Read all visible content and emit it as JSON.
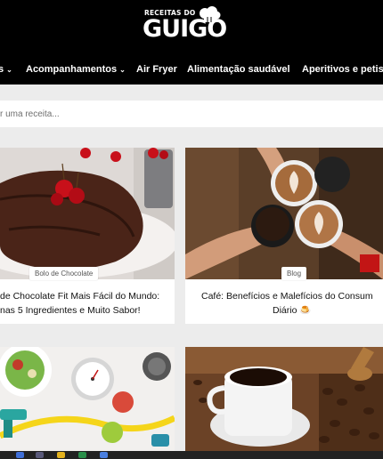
{
  "logo": {
    "top_text": "RECEITAS DO",
    "main_text": "GUIGO"
  },
  "nav": {
    "items": [
      {
        "label": "s",
        "has_chevron": true
      },
      {
        "label": "Acompanhamentos",
        "has_chevron": true
      },
      {
        "label": "Air Fryer",
        "has_chevron": false
      },
      {
        "label": "Alimentação saudável",
        "has_chevron": false
      },
      {
        "label": "Aperitivos e petisc",
        "has_chevron": false
      }
    ]
  },
  "search": {
    "placeholder": "r uma receita..."
  },
  "cards": [
    {
      "category": "Bolo de Chocolate",
      "title_line1": "de Chocolate Fit Mais Fácil do Mundo:",
      "title_line2": "nas 5 Ingredientes e Muito Sabor!"
    },
    {
      "category": "Blog",
      "title_line1": "Café: Benefícios e Malefícios do Consum",
      "title_line2": "Diário 🍮"
    }
  ],
  "colors": {
    "header_bg": "#000000",
    "page_bg": "#ececec",
    "card_bg": "#ffffff"
  }
}
